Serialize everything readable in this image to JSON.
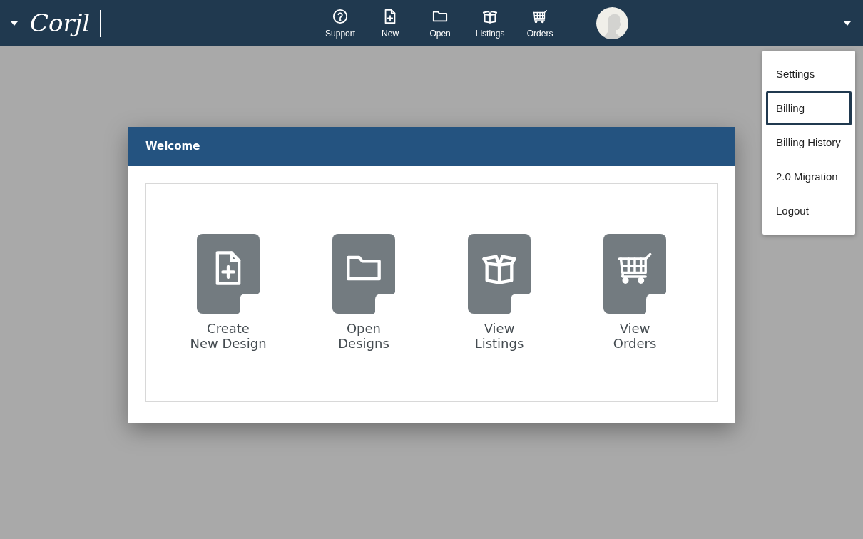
{
  "header": {
    "logo": "Corjl",
    "nav": [
      {
        "kind": "support",
        "label": "Support"
      },
      {
        "kind": "new",
        "label": "New"
      },
      {
        "kind": "open",
        "label": "Open"
      },
      {
        "kind": "listings",
        "label": "Listings"
      },
      {
        "kind": "orders",
        "label": "Orders"
      }
    ]
  },
  "user_menu": {
    "items": [
      {
        "label": "Settings",
        "selected": false
      },
      {
        "label": "Billing",
        "selected": true
      },
      {
        "label": "Billing History",
        "selected": false
      },
      {
        "label": "2.0 Migration",
        "selected": false
      },
      {
        "label": "Logout",
        "selected": false
      }
    ]
  },
  "dialog": {
    "title": "Welcome",
    "tiles": [
      {
        "kind": "new",
        "lines": [
          "Create",
          "New Design"
        ]
      },
      {
        "kind": "open",
        "lines": [
          "Open",
          "Designs"
        ]
      },
      {
        "kind": "listings",
        "lines": [
          "View",
          "Listings"
        ]
      },
      {
        "kind": "orders",
        "lines": [
          "View",
          "Orders"
        ]
      }
    ]
  }
}
